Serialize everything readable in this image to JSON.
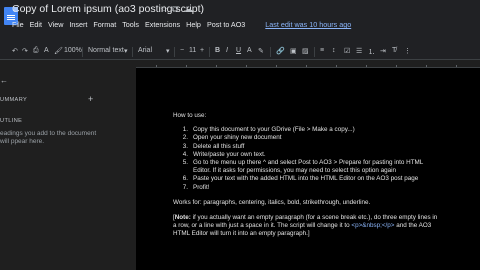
{
  "title": {
    "doc_title": "Copy of Lorem ipsum (ao3 posting script)",
    "star_icon": "star-outline-icon",
    "move_icon": "folder-move-icon",
    "cloud_icon": "cloud-status-icon"
  },
  "menu": {
    "items": [
      "File",
      "Edit",
      "View",
      "Insert",
      "Format",
      "Tools",
      "Extensions",
      "Help",
      "Post to AO3"
    ],
    "last_edit": "Last edit was 10 hours ago"
  },
  "toolbar": {
    "style": "Normal text",
    "font": "Arial",
    "font_size": "11",
    "caret": "▾",
    "decrease": "−",
    "increase": "+",
    "undo_glyph": "↶",
    "redo_glyph": "↷",
    "print_glyph": "⎙",
    "spell_glyph": "A",
    "paint_glyph": "🖌",
    "zoom_glyph": "100%",
    "bold": "B",
    "italic": "I",
    "underline": "U",
    "text_color": "A",
    "highlight": "✎",
    "link": "🔗",
    "comment": "▣",
    "image": "▨",
    "align": "≡",
    "line_spacing": "↕",
    "checklist": "☑",
    "bullets": "☰",
    "numbered": "⒈",
    "indent": "⇥",
    "clear": "T̸",
    "more": "⋮"
  },
  "sidebar": {
    "back": "←",
    "summary_heading": "UMMARY",
    "add": "+",
    "outline_heading": "UTLINE",
    "outline_text": "eadings you add to the document will ppear here."
  },
  "document": {
    "how_to": "How to use:",
    "steps": [
      {
        "num": "1.",
        "text": "Copy this document to your GDrive (File > Make a copy...)"
      },
      {
        "num": "2.",
        "text": "Open your shiny new document"
      },
      {
        "num": "3.",
        "text": "Delete all this stuff"
      },
      {
        "num": "4.",
        "text": "Write/paste your own text."
      },
      {
        "num": "5.",
        "text": "Go to the menu up there ^ and select Post to AO3 > Prepare for pasting into HTML Editor. If it asks for permissions, you may need to select this option again"
      },
      {
        "num": "6.",
        "text": "Paste your text with the added HTML into the HTML Editor on the AO3 post page"
      },
      {
        "num": "7.",
        "text": "Profit!"
      }
    ],
    "works_for": "Works for: paragraphs, centering, italics, bold, strikethrough, underline.",
    "note_open": "[",
    "note_label": "Note:",
    "note_text_1": " if you actually want an empty paragraph (for a scene break etc.), do three empty lines in a row, or a line with just a space in it. The script will change it to ",
    "note_code": "<p>&nbsp;</p>",
    "note_text_2": " and the AO3 HTML Editor will turn it into an empty paragraph.]"
  },
  "colors": {
    "background": "#1f1f1f",
    "page": "#000000",
    "link": "#8ab4f8",
    "doc_icon": "#4285f4"
  }
}
